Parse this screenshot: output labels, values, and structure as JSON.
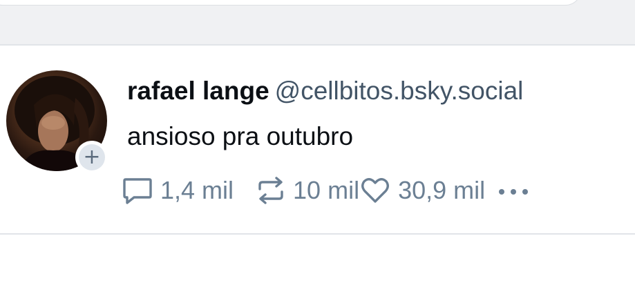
{
  "post": {
    "display_name": "rafael lange",
    "handle": "@cellbitos.bsky.social",
    "text": "ansioso pra outubro",
    "follow_badge": "+",
    "actions": {
      "reply_count": "1,4 mil",
      "repost_count": "10 mil",
      "like_count": "30,9 mil"
    },
    "icons": {
      "reply": "comment-bubble-icon",
      "repost": "repost-arrows-icon",
      "like": "heart-icon",
      "more": "more-dots-icon"
    }
  },
  "colors": {
    "background": "#ffffff",
    "top_band": "#f0f1f3",
    "divider": "#e1e4e8",
    "text_primary": "#0b0f14",
    "handle": "#425466",
    "action": "#6b7f93",
    "badge_bg": "#dfe5ec"
  }
}
